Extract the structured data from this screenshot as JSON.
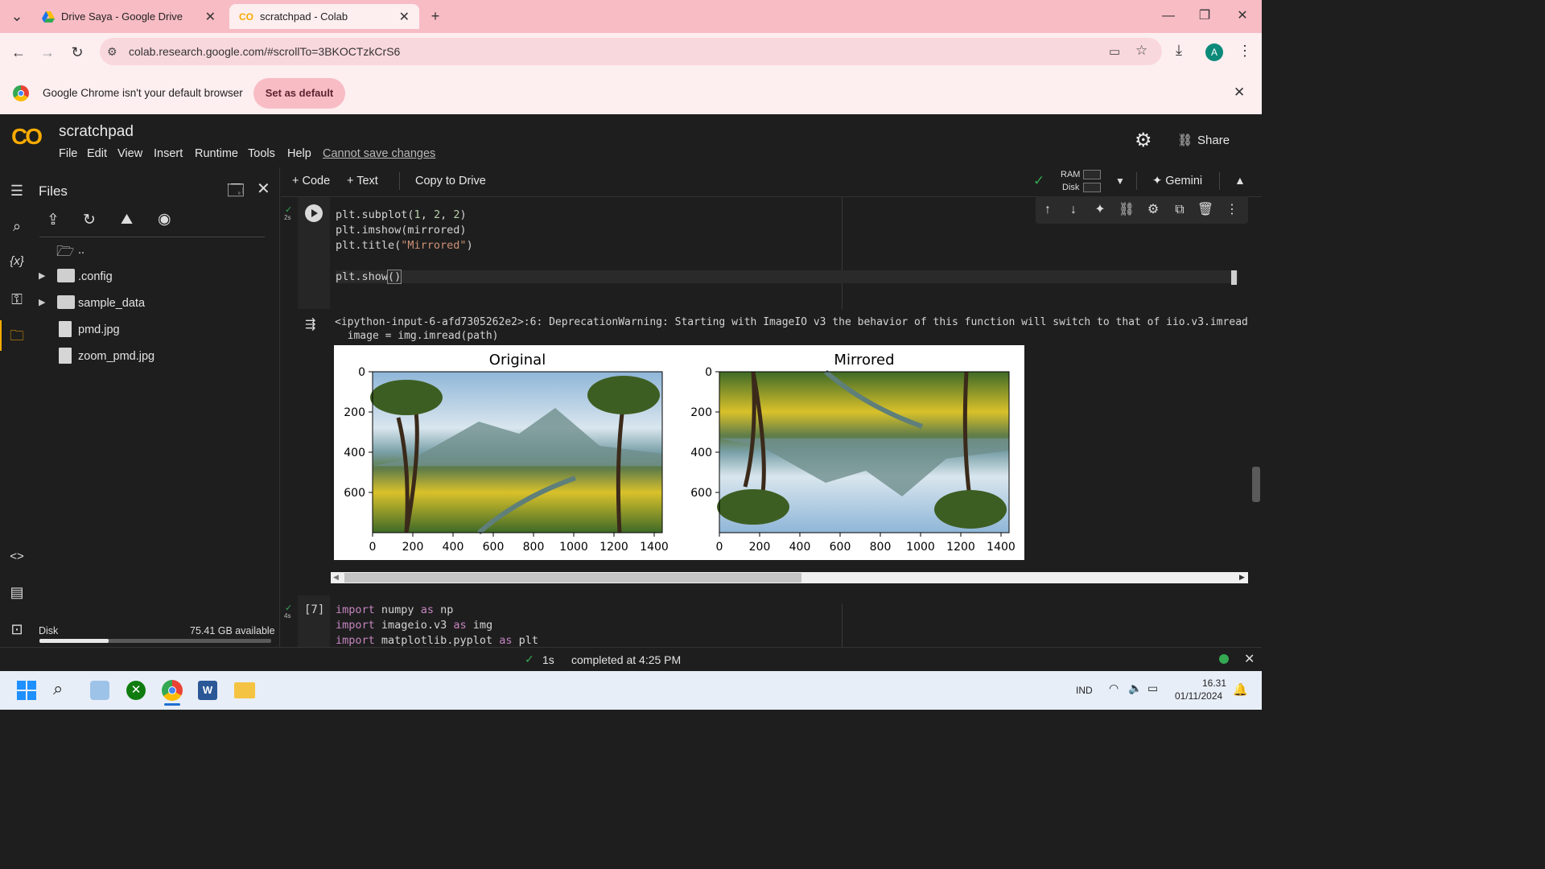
{
  "browser": {
    "tabs": [
      {
        "title": "Drive Saya - Google Drive"
      },
      {
        "title": "scratchpad - Colab"
      }
    ],
    "url": "colab.research.google.com/#scrollTo=3BKOCTzkCrS6",
    "profile_initial": "A",
    "infobar_text": "Google Chrome isn't your default browser",
    "infobar_button": "Set as default"
  },
  "colab": {
    "logo": "CO",
    "title": "scratchpad",
    "menu": [
      "File",
      "Edit",
      "View",
      "Insert",
      "Runtime",
      "Tools",
      "Help"
    ],
    "cannot_save": "Cannot save changes",
    "share": "Share",
    "toolbar": {
      "code": "Code",
      "text": "Text",
      "copy_to_drive": "Copy to Drive",
      "ram": "RAM",
      "disk": "Disk",
      "gemini": "Gemini"
    }
  },
  "files": {
    "title": "Files",
    "items": [
      {
        "name": "..",
        "type": "folder-open"
      },
      {
        "name": ".config",
        "type": "folder"
      },
      {
        "name": "sample_data",
        "type": "folder"
      },
      {
        "name": "pmd.jpg",
        "type": "file"
      },
      {
        "name": "zoom_pmd.jpg",
        "type": "file"
      }
    ],
    "disk_label": "Disk",
    "disk_available": "75.41 GB available",
    "disk_used_fraction": 0.3
  },
  "cell6": {
    "exec_time": "2s",
    "lines": [
      "plt.subplot(1, 2, 2)",
      "plt.imshow(mirrored)",
      "plt.title(\"Mirrored\")",
      "",
      "plt.show()"
    ],
    "warning_line1": "<ipython-input-6-afd7305262e2>:6: DeprecationWarning: Starting with ImageIO v3 the behavior of this function will switch to that of iio.v3.imread",
    "warning_line2": "  image = img.imread(path)"
  },
  "chart_data": [
    {
      "type": "image",
      "title": "Original",
      "x_ticks": [
        "0",
        "200",
        "400",
        "600",
        "800",
        "1000",
        "1200",
        "1400"
      ],
      "y_ticks": [
        "0",
        "200",
        "400",
        "600"
      ],
      "xlim": [
        0,
        1440
      ],
      "ylim": [
        800,
        0
      ]
    },
    {
      "type": "image",
      "title": "Mirrored",
      "x_ticks": [
        "0",
        "200",
        "400",
        "600",
        "800",
        "1000",
        "1200",
        "1400"
      ],
      "y_ticks": [
        "0",
        "200",
        "400",
        "600"
      ],
      "xlim": [
        0,
        1440
      ],
      "ylim": [
        800,
        0
      ]
    }
  ],
  "cell7": {
    "label": "[7]",
    "exec_time": "4s",
    "lines": [
      {
        "kw": "import",
        "mod": "numpy",
        "as": "as",
        "alias": "np"
      },
      {
        "kw": "import",
        "mod": "imageio.v3",
        "as": "as",
        "alias": "img"
      },
      {
        "kw": "import",
        "mod": "matplotlib.pyplot",
        "as": "as",
        "alias": "plt"
      }
    ]
  },
  "status": {
    "duration": "1s",
    "completed": "completed at 4:25 PM"
  },
  "taskbar": {
    "language": "IND",
    "time": "16.31",
    "date": "01/11/2024"
  },
  "colors": {
    "chrome_tabstrip": "#f8bcc5",
    "colab_bg": "#1e1e1e",
    "accent_orange": "#f9ab00",
    "ok_green": "#34a853"
  }
}
